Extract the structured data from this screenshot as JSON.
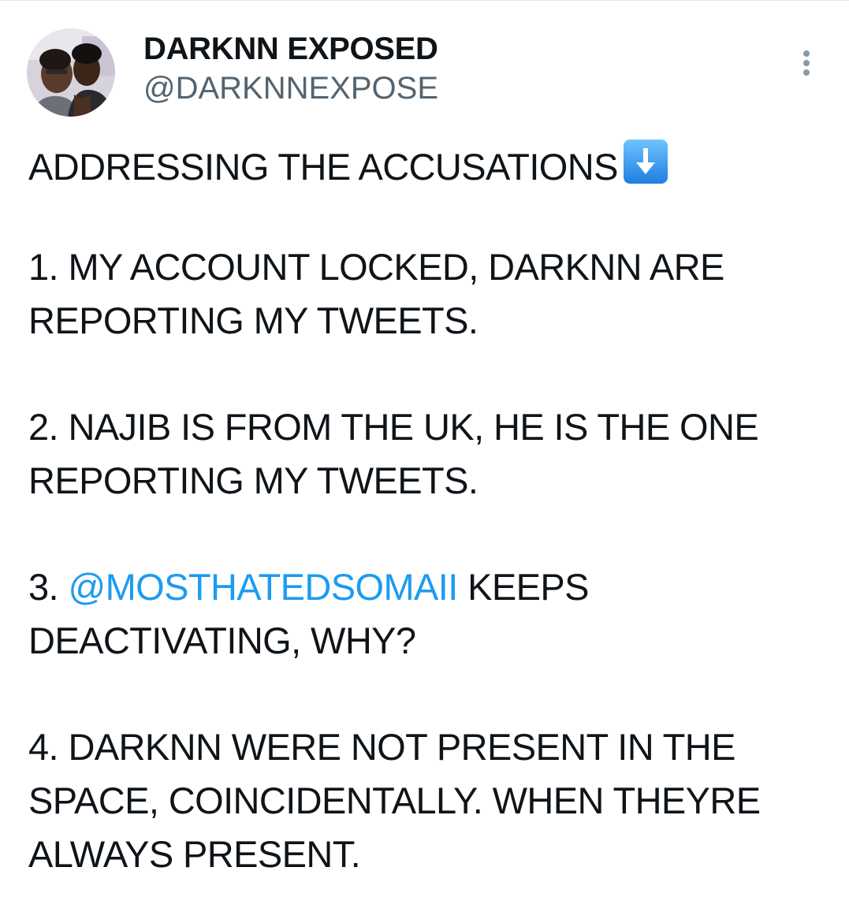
{
  "author": {
    "display_name": "DARKNN EXPOSED",
    "handle": "@DARKNNEXPOSE"
  },
  "tweet": {
    "heading": "ADDRESSING THE ACCUSATIONS",
    "heading_emoji": "down-arrow-emoji",
    "points": [
      {
        "line1": "1. MY ACCOUNT LOCKED, DARKNN ARE",
        "line2": "REPORTING MY TWEETS."
      },
      {
        "line1": "2. NAJIB IS FROM THE UK, HE IS THE ONE",
        "line2": "REPORTING MY TWEETS."
      },
      {
        "prefix": "3. ",
        "mention": "@MOSTHATEDSOMAII",
        "suffix": " KEEPS",
        "line2": "DEACTIVATING, WHY?"
      },
      {
        "line1": "4. DARKNN WERE NOT PRESENT IN THE",
        "line2": "SPACE, COINCIDENTALLY. WHEN THEYRE",
        "line3": "ALWAYS PRESENT."
      }
    ]
  },
  "icons": {
    "more": "more-options-icon",
    "avatar": "avatar"
  },
  "colors": {
    "text": "#0f1419",
    "secondary": "#536471",
    "link": "#1d9bf0",
    "emoji_blue": "#2f8ee6"
  }
}
